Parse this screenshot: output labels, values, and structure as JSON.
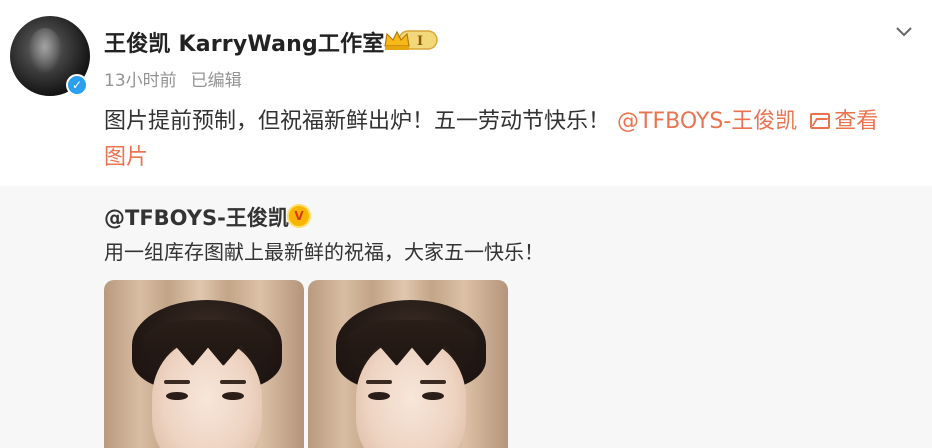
{
  "post": {
    "username": "王俊凯 KarryWang工作室",
    "vip_level": "I",
    "time": "13小时前",
    "edited": "已编辑",
    "text_main": "图片提前预制，但祝福新鲜出炉！五一劳动节快乐！",
    "mention": "@TFBOYS-王俊凯",
    "view_pic_line1": "查看",
    "view_pic_line2": "图片",
    "colors": {
      "link": "#eb7350",
      "meta": "#939393",
      "verified": "#2aa0f0"
    },
    "icons": [
      "verified-icon",
      "vip-crown-icon",
      "chevron-down-icon",
      "picture-icon"
    ]
  },
  "repost": {
    "username": "@TFBOYS-王俊凯",
    "badge_icon": "gold-verified-icon",
    "text": "用一组库存图献上最新鲜的祝福，大家五一快乐！",
    "images": [
      {
        "alt": "photo-1"
      },
      {
        "alt": "photo-2"
      }
    ]
  }
}
